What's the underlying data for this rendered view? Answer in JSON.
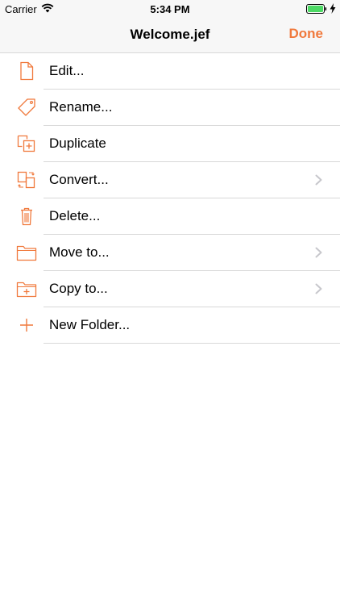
{
  "status_bar": {
    "carrier": "Carrier",
    "time": "5:34 PM",
    "battery_color": "#4cd964"
  },
  "nav": {
    "title": "Welcome.jef",
    "done_label": "Done"
  },
  "accent_color": "#f0793c",
  "menu": {
    "items": [
      {
        "label": "Edit...",
        "icon": "document-icon",
        "has_chevron": false
      },
      {
        "label": "Rename...",
        "icon": "tag-icon",
        "has_chevron": false
      },
      {
        "label": "Duplicate",
        "icon": "duplicate-icon",
        "has_chevron": false
      },
      {
        "label": "Convert...",
        "icon": "convert-icon",
        "has_chevron": true
      },
      {
        "label": "Delete...",
        "icon": "trash-icon",
        "has_chevron": false
      },
      {
        "label": "Move to...",
        "icon": "folder-icon",
        "has_chevron": true
      },
      {
        "label": "Copy to...",
        "icon": "folder-add-icon",
        "has_chevron": true
      },
      {
        "label": "New Folder...",
        "icon": "plus-icon",
        "has_chevron": false
      }
    ]
  }
}
